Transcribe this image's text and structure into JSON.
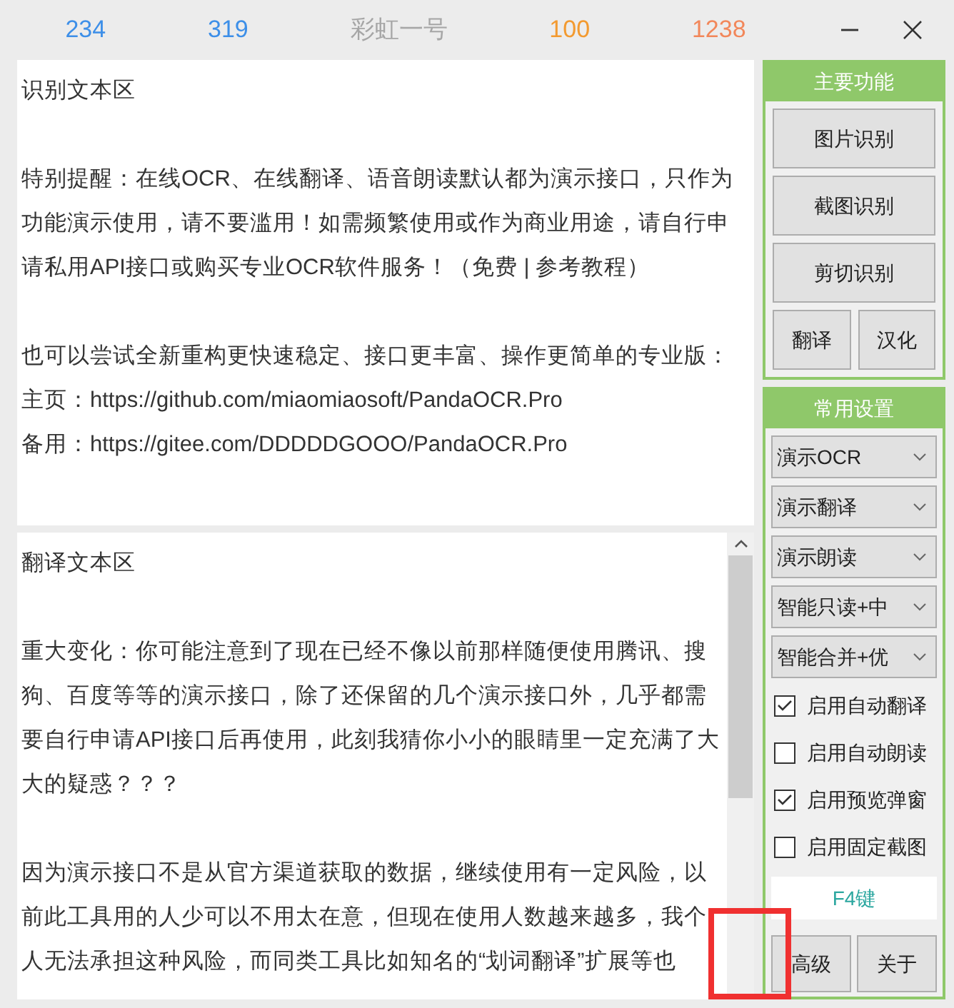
{
  "title_bar": {
    "counters": [
      {
        "text": "234",
        "color": "#3d8fe8"
      },
      {
        "text": "319",
        "color": "#3d8fe8"
      },
      {
        "text": "彩虹一号",
        "color": "#a6a6a6"
      },
      {
        "text": "100",
        "color": "#f39a30"
      },
      {
        "text": "1238",
        "color": "#f2875a"
      }
    ]
  },
  "ocr_text_area": {
    "paragraphs": [
      "识别文本区",
      "特别提醒：在线OCR、在线翻译、语音朗读默认都为演示接口，只作为功能演示使用，请不要滥用！如需频繁使用或作为商业用途，请自行申请私用API接口或购买专业OCR软件服务！（免费 | 参考教程）",
      "也可以尝试全新重构更快速稳定、接口更丰富、操作更简单的专业版：",
      "主页：https://github.com/miaomiaosoft/PandaOCR.Pro",
      "备用：https://gitee.com/DDDDDGOOO/PandaOCR.Pro"
    ]
  },
  "translation_text_area": {
    "paragraphs": [
      "翻译文本区",
      "重大变化：你可能注意到了现在已经不像以前那样随便使用腾讯、搜狗、百度等等的演示接口，除了还保留的几个演示接口外，几乎都需要自行申请API接口后再使用，此刻我猜你小小的眼睛里一定充满了大大的疑惑？？？",
      "因为演示接口不是从官方渠道获取的数据，继续使用有一定风险，以前此工具用的人少可以不用太在意，但现在使用人数越来越多，我个人无法承担这种风险，而同类工具比如知名的“划词翻译”扩展等也"
    ]
  },
  "main_functions": {
    "title": "主要功能",
    "buttons": [
      "图片识别",
      "截图识别",
      "剪切识别"
    ],
    "small_buttons": [
      "翻译",
      "汉化"
    ]
  },
  "common_settings": {
    "title": "常用设置",
    "dropdowns": [
      "演示OCR",
      "演示翻译",
      "演示朗读",
      "智能只读+中",
      "智能合并+优"
    ],
    "checkboxes": [
      {
        "label": "启用自动翻译",
        "checked": true
      },
      {
        "label": "启用自动朗读",
        "checked": false
      },
      {
        "label": "启用预览弹窗",
        "checked": true
      },
      {
        "label": "启用固定截图",
        "checked": false
      }
    ],
    "hotkey_field": "F4键"
  },
  "bottom_buttons": [
    "高级",
    "关于"
  ]
}
